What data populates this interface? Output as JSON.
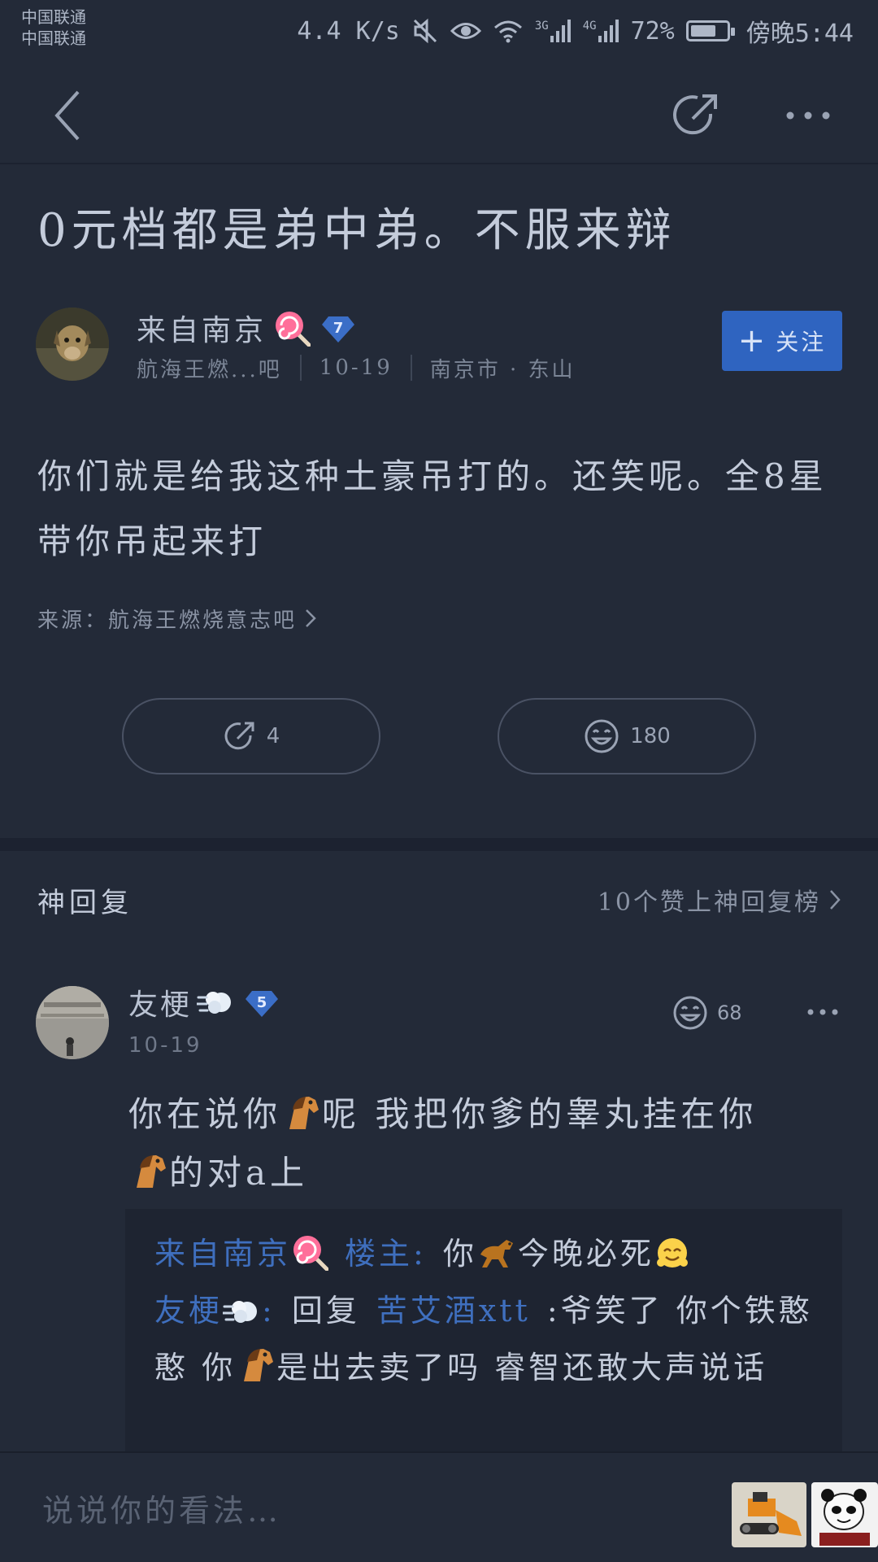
{
  "status_bar": {
    "carrier_1": "中国联通",
    "carrier_2": "中国联通",
    "net_speed": "4.4 K/s",
    "sig_3g": "3G",
    "sig_4g": "4G",
    "battery": "72%",
    "battery_level": 0.72,
    "time": "傍晚5:44"
  },
  "nav": {
    "icons": [
      "back-icon",
      "share-icon",
      "more-icon"
    ]
  },
  "post": {
    "title": "0元档都是弟中弟。不服来辩",
    "author": {
      "name": "来自南京",
      "level": "7",
      "forum": "航海王燃...吧",
      "date": "10-19",
      "location": "南京市 · 东山"
    },
    "follow_label": "关注",
    "body": "你们就是给我这种土豪吊打的。还笑呢。全8星带你吊起来打",
    "source_label": "来源：航海王燃烧意志吧",
    "share_count": "4",
    "like_count": "180"
  },
  "god_reply": {
    "title": "神回复",
    "link": "10个赞上神回复榜",
    "reply": {
      "name": "友梗",
      "level": "5",
      "date": "10-19",
      "like_count": "68",
      "body_part1": "你在说你",
      "body_part2": "呢 我把你爹的睾丸挂在你",
      "body_part3": "的对a上"
    },
    "subreplies": {
      "s1_user": "来自南京",
      "s1_tag": "楼主:",
      "s1_text_a": "你",
      "s1_text_b": "今晚必死",
      "s2_user": "友梗",
      "s2_colon": ":",
      "s2_reply_word": "回复",
      "s2_target": "苦艾酒xtt",
      "s2_text_a": ":爷笑了 你个铁憨憨 你",
      "s2_text_b": "是出去卖了吗 睿智还敢大声说话"
    }
  },
  "comment_bar": {
    "placeholder": "说说你的看法…"
  },
  "colors": {
    "background": "#232a38",
    "accent_blue": "#2f64c0",
    "link_blue": "#3f6fbe"
  }
}
